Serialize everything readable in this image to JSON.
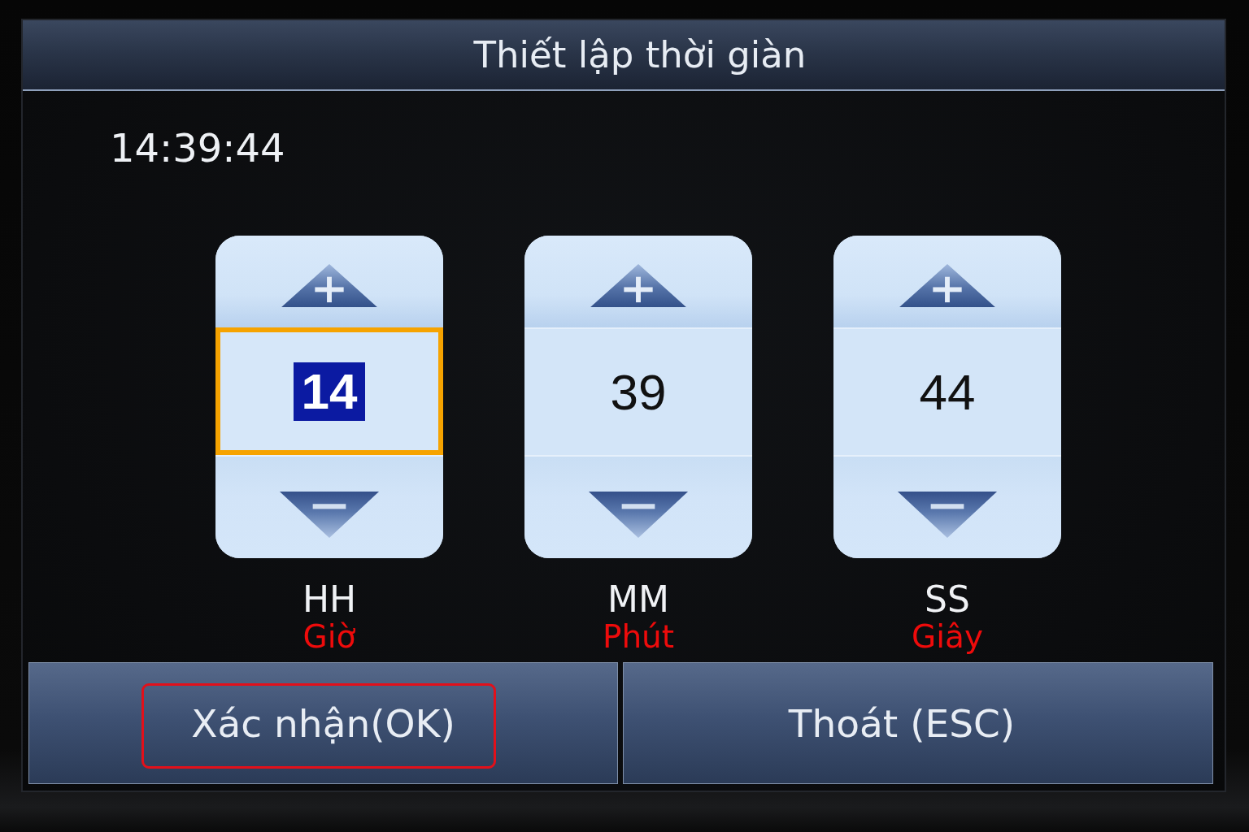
{
  "title": "Thiết lập thời giàn",
  "current_time": "14:39:44",
  "spinners": [
    {
      "code": "HH",
      "annotation": "Giờ",
      "value": "14",
      "selected": true
    },
    {
      "code": "MM",
      "annotation": "Phút",
      "value": "39",
      "selected": false
    },
    {
      "code": "SS",
      "annotation": "Giây",
      "value": "44",
      "selected": false
    }
  ],
  "buttons": [
    {
      "label": "Xác nhận(OK)",
      "annotated": true
    },
    {
      "label": "Thoát (ESC)",
      "annotated": false
    }
  ]
}
